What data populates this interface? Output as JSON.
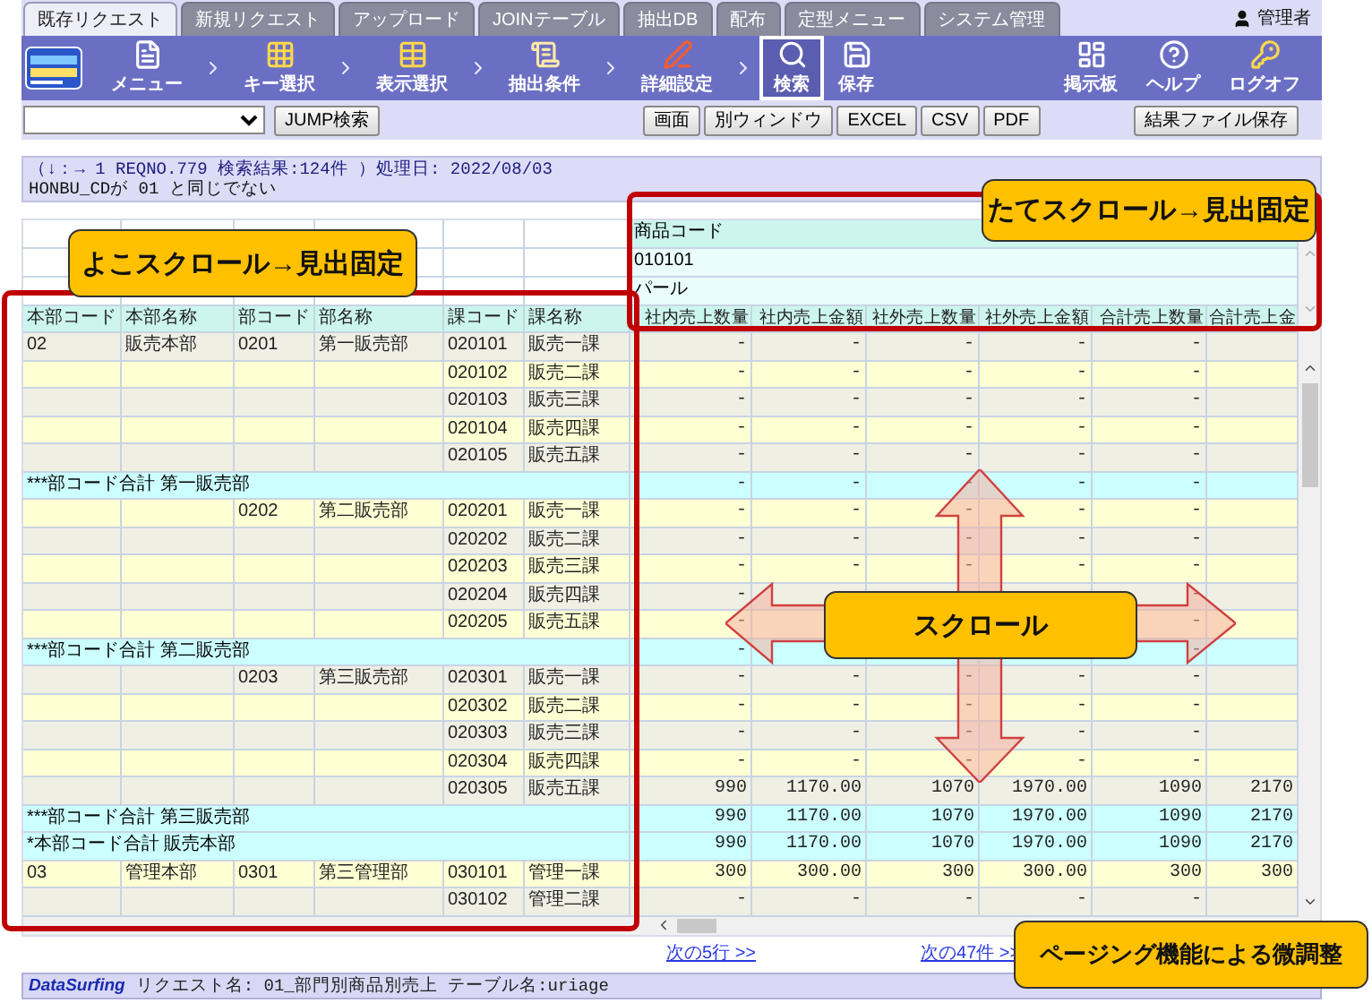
{
  "tabs": [
    {
      "label": "既存リクエスト",
      "selected": true
    },
    {
      "label": "新規リクエスト",
      "selected": false
    },
    {
      "label": "アップロード",
      "selected": false
    },
    {
      "label": "JOINテーブル",
      "selected": false
    },
    {
      "label": "抽出DB",
      "selected": false
    },
    {
      "label": "配布",
      "selected": false
    },
    {
      "label": "定型メニュー",
      "selected": false
    },
    {
      "label": "システム管理",
      "selected": false
    }
  ],
  "user": "管理者",
  "toolbar": [
    {
      "label": "メニュー",
      "kind": "step",
      "selected": false
    },
    {
      "label": "キー選択",
      "kind": "step",
      "selected": false
    },
    {
      "label": "表示選択",
      "kind": "step",
      "selected": false
    },
    {
      "label": "抽出条件",
      "kind": "step",
      "selected": false
    },
    {
      "label": "詳細設定",
      "kind": "step",
      "selected": false
    },
    {
      "label": "検索",
      "kind": "action",
      "selected": true
    },
    {
      "label": "保存",
      "kind": "action",
      "selected": false
    }
  ],
  "tools": [
    "掲示板",
    "ヘルプ",
    "ログオフ"
  ],
  "jump_button": "JUMP検索",
  "output_buttons": [
    "画面",
    "別ウィンドウ",
    "EXCEL",
    "CSV",
    "PDF"
  ],
  "save_result_button": "結果ファイル保存",
  "info": [
    "（↓：→ 1 REQNO.779 検索結果:124件 ）処理日: 2022/08/03",
    "HONBU_CDが 01 と同じでない"
  ],
  "grid": {
    "left_columns": [
      "本部コード",
      "本部名称",
      "部コード",
      "部名称",
      "課コード",
      "課名称"
    ],
    "right_header_rows": [
      "商品コード",
      "010101",
      "パール"
    ],
    "right_columns": [
      "社内売上数量",
      "社内売上金額",
      "社外売上数量",
      "社外売上金額",
      "合計売上数量",
      "合計売上金"
    ],
    "rows": [
      {
        "kind": "detail",
        "cells": {
          "honbu_code": "02",
          "honbu_name": "販売本部",
          "bu_code": "0201",
          "bu_name": "第一販売部",
          "ka_code": "020101",
          "ka_name": "販売一課"
        },
        "values": {
          "in_qty": "-",
          "in_amount": "-",
          "out_qty": "-",
          "out_amount": "-",
          "total_qty": "-"
        }
      },
      {
        "kind": "detail",
        "cells": {
          "ka_code": "020102",
          "ka_name": "販売二課"
        },
        "values": {
          "in_qty": "-",
          "in_amount": "-",
          "out_qty": "-",
          "out_amount": "-",
          "total_qty": "-"
        }
      },
      {
        "kind": "detail",
        "cells": {
          "ka_code": "020103",
          "ka_name": "販売三課"
        },
        "values": {
          "in_qty": "-",
          "in_amount": "-",
          "out_qty": "-",
          "out_amount": "-",
          "total_qty": "-"
        }
      },
      {
        "kind": "detail",
        "cells": {
          "ka_code": "020104",
          "ka_name": "販売四課"
        },
        "values": {
          "in_qty": "-",
          "in_amount": "-",
          "out_qty": "-",
          "out_amount": "-",
          "total_qty": "-"
        }
      },
      {
        "kind": "detail",
        "cells": {
          "ka_code": "020105",
          "ka_name": "販売五課"
        },
        "values": {
          "in_qty": "-",
          "in_amount": "-",
          "out_qty": "-",
          "out_amount": "-",
          "total_qty": "-"
        }
      },
      {
        "kind": "subtotal",
        "label": "***部コード合計 第一販売部",
        "values": {
          "in_qty": "-",
          "in_amount": "-",
          "out_qty": "-",
          "out_amount": "-",
          "total_qty": "-"
        }
      },
      {
        "kind": "detail",
        "cells": {
          "bu_code": "0202",
          "bu_name": "第二販売部",
          "ka_code": "020201",
          "ka_name": "販売一課"
        },
        "values": {
          "in_qty": "-",
          "in_amount": "-",
          "out_qty": "-",
          "out_amount": "-",
          "total_qty": "-"
        }
      },
      {
        "kind": "detail",
        "cells": {
          "ka_code": "020202",
          "ka_name": "販売二課"
        },
        "values": {
          "in_qty": "-",
          "in_amount": "-",
          "out_qty": "-",
          "out_amount": "-",
          "total_qty": "-"
        }
      },
      {
        "kind": "detail",
        "cells": {
          "ka_code": "020203",
          "ka_name": "販売三課"
        },
        "values": {
          "in_qty": "-",
          "in_amount": "-",
          "out_qty": "-",
          "out_amount": "-",
          "total_qty": "-"
        }
      },
      {
        "kind": "detail",
        "cells": {
          "ka_code": "020204",
          "ka_name": "販売四課"
        },
        "values": {
          "in_qty": "-",
          "total_qty": "-"
        }
      },
      {
        "kind": "detail",
        "cells": {
          "ka_code": "020205",
          "ka_name": "販売五課"
        },
        "values": {
          "in_qty": "-",
          "total_qty": "-"
        }
      },
      {
        "kind": "subtotal",
        "label": "***部コード合計 第二販売部",
        "values": {
          "in_qty": "-",
          "total_qty": "-"
        }
      },
      {
        "kind": "detail",
        "cells": {
          "bu_code": "0203",
          "bu_name": "第三販売部",
          "ka_code": "020301",
          "ka_name": "販売一課"
        },
        "values": {
          "in_qty": "-",
          "in_amount": "-",
          "out_qty": "-",
          "out_amount": "-",
          "total_qty": "-"
        }
      },
      {
        "kind": "detail",
        "cells": {
          "ka_code": "020302",
          "ka_name": "販売二課"
        },
        "values": {
          "in_qty": "-",
          "in_amount": "-",
          "out_qty": "-",
          "out_amount": "-",
          "total_qty": "-"
        }
      },
      {
        "kind": "detail",
        "cells": {
          "ka_code": "020303",
          "ka_name": "販売三課"
        },
        "values": {
          "in_qty": "-",
          "in_amount": "-",
          "out_qty": "-",
          "out_amount": "-",
          "total_qty": "-"
        }
      },
      {
        "kind": "detail",
        "cells": {
          "ka_code": "020304",
          "ka_name": "販売四課"
        },
        "values": {
          "in_qty": "-",
          "in_amount": "-",
          "out_qty": "-",
          "out_amount": "-",
          "total_qty": "-"
        }
      },
      {
        "kind": "detail",
        "cells": {
          "ka_code": "020305",
          "ka_name": "販売五課"
        },
        "values": {
          "in_qty": "990",
          "in_amount": "1170.00",
          "out_qty": "1070",
          "out_amount": "1970.00",
          "total_qty": "1090",
          "total_amount": "2170"
        }
      },
      {
        "kind": "subtotal",
        "label": "***部コード合計 第三販売部",
        "values": {
          "in_qty": "990",
          "in_amount": "1170.00",
          "out_qty": "1070",
          "out_amount": "1970.00",
          "total_qty": "1090",
          "total_amount": "2170"
        }
      },
      {
        "kind": "subtotal",
        "label": "*本部コード合計 販売本部",
        "values": {
          "in_qty": "990",
          "in_amount": "1170.00",
          "out_qty": "1070",
          "out_amount": "1970.00",
          "total_qty": "1090",
          "total_amount": "2170"
        }
      },
      {
        "kind": "detail",
        "cells": {
          "honbu_code": "03",
          "honbu_name": "管理本部",
          "bu_code": "0301",
          "bu_name": "第三管理部",
          "ka_code": "030101",
          "ka_name": "管理一課"
        },
        "values": {
          "in_qty": "300",
          "in_amount": "300.00",
          "out_qty": "300",
          "out_amount": "300.00",
          "total_qty": "300",
          "total_amount": "300"
        }
      },
      {
        "kind": "detail",
        "cells": {
          "ka_code": "030102",
          "ka_name": "管理二課"
        },
        "values": {
          "in_qty": "-",
          "in_amount": "-",
          "out_qty": "-",
          "out_amount": "-",
          "total_qty": "-"
        }
      }
    ]
  },
  "pager": [
    "次の5行 >>",
    "次の47件 >>"
  ],
  "status": {
    "brand": "DataSurfing",
    "text": "リクエスト名: 01_部門別商品別売上 テーブル名:uriage"
  },
  "annotations": [
    {
      "kind": "horizontal",
      "text": "よこスクロール→見出固定"
    },
    {
      "kind": "vertical",
      "text": "たてスクロール→見出固定"
    },
    {
      "kind": "scroll",
      "text": "スクロール"
    },
    {
      "kind": "paging",
      "text": "ページング機能による微調整"
    }
  ]
}
